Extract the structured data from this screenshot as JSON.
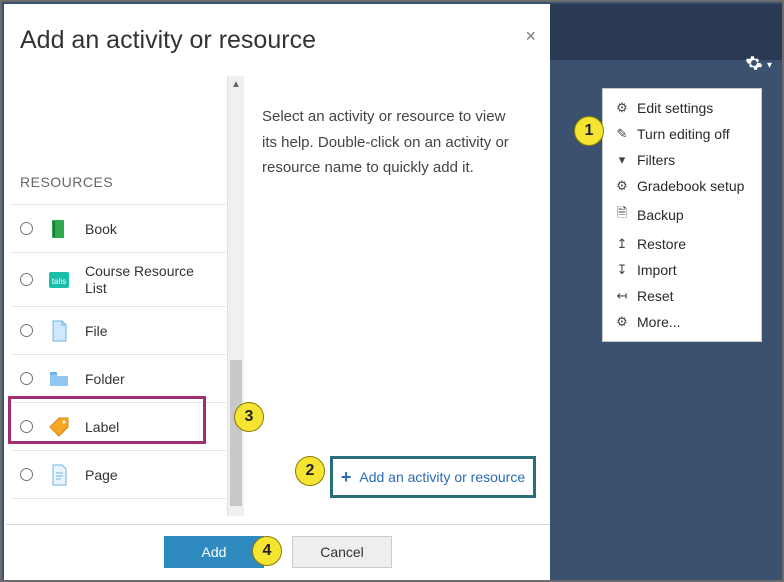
{
  "dialog": {
    "title": "Add an activity or resource",
    "close_glyph": "×",
    "help_text": "Select an activity or resource to view its help. Double-click on an activity or resource name to quickly add it.",
    "section_header": "RESOURCES",
    "resources": [
      {
        "label": "Book",
        "icon": "book-icon"
      },
      {
        "label": "Course Resource List",
        "icon": "talis-icon"
      },
      {
        "label": "File",
        "icon": "file-icon"
      },
      {
        "label": "Folder",
        "icon": "folder-icon"
      },
      {
        "label": "Label",
        "icon": "label-icon"
      },
      {
        "label": "Page",
        "icon": "page-icon"
      }
    ],
    "highlighted_resource_index": 4,
    "add_activity_link": "Add an activity or resource",
    "footer": {
      "add_label": "Add",
      "cancel_label": "Cancel"
    }
  },
  "settings_menu": {
    "items": [
      {
        "label": "Edit settings",
        "icon": "gear"
      },
      {
        "label": "Turn editing off",
        "icon": "pencil"
      },
      {
        "label": "Filters",
        "icon": "funnel"
      },
      {
        "label": "Gradebook setup",
        "icon": "gear"
      },
      {
        "label": "Backup",
        "icon": "doc"
      },
      {
        "label": "Restore",
        "icon": "up-arrow"
      },
      {
        "label": "Import",
        "icon": "down-arrow"
      },
      {
        "label": "Reset",
        "icon": "left-arrow"
      },
      {
        "label": "More...",
        "icon": "gear"
      }
    ]
  },
  "annotations": {
    "1": "1",
    "2": "2",
    "3": "3",
    "4": "4"
  }
}
